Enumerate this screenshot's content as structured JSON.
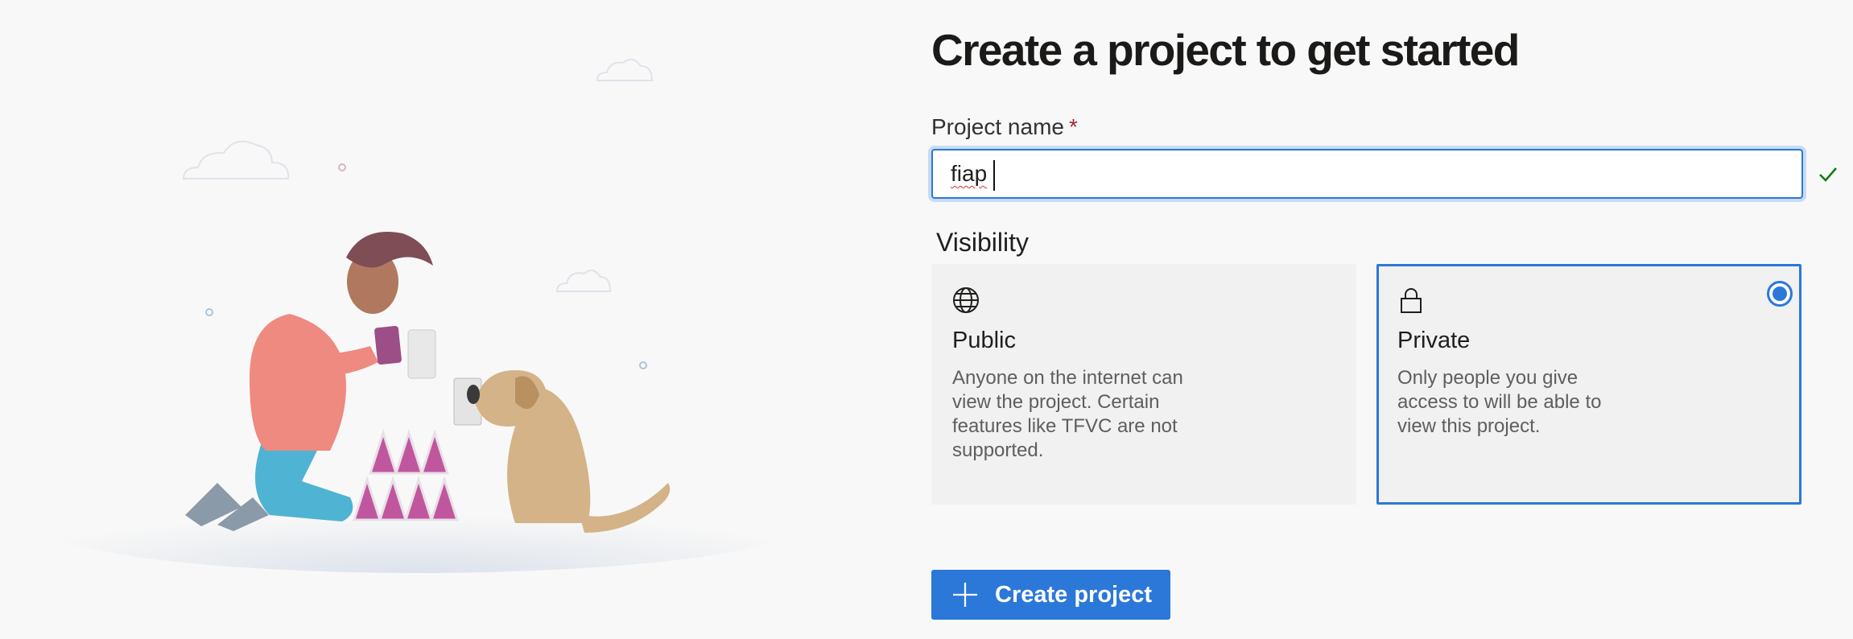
{
  "page": {
    "title": "Create a project to get started"
  },
  "project_name": {
    "label": "Project name",
    "required_marker": "*",
    "value": "fiap",
    "placeholder": ""
  },
  "visibility": {
    "label": "Visibility",
    "options": [
      {
        "id": "public",
        "title": "Public",
        "icon": "globe-icon",
        "description": "Anyone on the internet can view the project. Certain features like TFVC are not supported.",
        "selected": false
      },
      {
        "id": "private",
        "title": "Private",
        "icon": "lock-icon",
        "description": "Only people you give access to will be able to view this project.",
        "selected": true
      }
    ]
  },
  "actions": {
    "create_label": "Create project",
    "create_icon": "plus-icon"
  },
  "colors": {
    "accent": "#2b78d8",
    "background": "#f8f8f8",
    "card": "#f1f1f1",
    "valid": "#107c10",
    "required": "#a4262c"
  }
}
